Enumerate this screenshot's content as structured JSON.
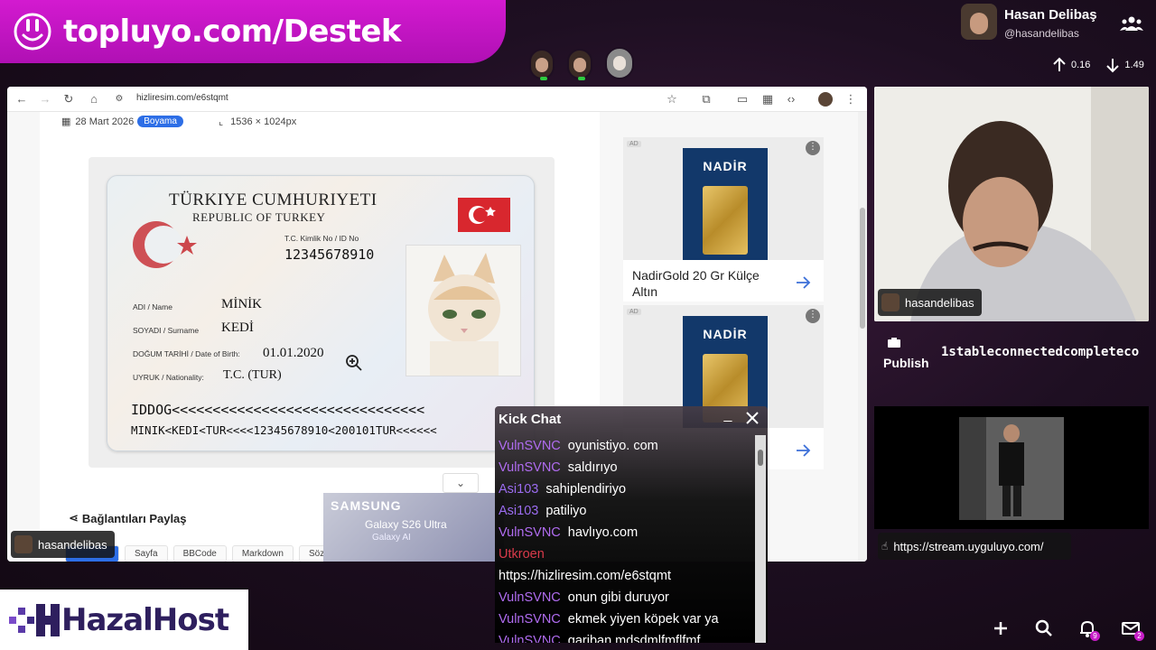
{
  "banner": {
    "text": "topluyo.com/Destek"
  },
  "profile": {
    "name": "Hasan Delibaş",
    "handle": "@hasandelibas"
  },
  "speed": {
    "up": "0.16",
    "down": "1.49"
  },
  "browser": {
    "url": "hizliresim.com/e6stqmt",
    "date": "28 Mart 2026",
    "category": "Boyama",
    "dimensions": "1536 × 1024px",
    "share_label": "Bağlantıları Paylaş",
    "share_tabs": [
      "Sayfa",
      "BBCode",
      "Markdown",
      "Söz"
    ]
  },
  "idcard": {
    "title1": "TÜRKIYE CUMHURIYETI",
    "title2": "REPUBLIC OF TURKEY",
    "id_label": "T.C. Kimlik No / ID No",
    "id_no": "12345678910",
    "name_label": "ADI / Name",
    "name": "MİNİK",
    "surname_label": "SOYADI / Surname",
    "surname": "KEDİ",
    "dob_label": "DOĞUM TARİHİ / Date of Birth:",
    "dob": "01.01.2020",
    "nat_label": "UYRUK / Nationality:",
    "nationality": "T.C. (TUR)",
    "mrz1": "IDDOG<<<<<<<<<<<<<<<<<<<<<<<<<<<<<<<",
    "mrz2": "MINIK<KEDI<TUR<<<<12345678910<200101TUR<<<<<<"
  },
  "samsung_ad": {
    "brand": "SAMSUNG",
    "model": "Galaxy S26 Ultra",
    "tagline": "Galaxy AI"
  },
  "ads": [
    {
      "tag": "AD",
      "brand": "NADİR",
      "title": "NadirGold 20 Gr Külçe Altın"
    },
    {
      "tag": "AD",
      "brand": "NADİR",
      "title": ""
    }
  ],
  "streamer_overlay": "hasandelibas",
  "publish": {
    "label": "Publish",
    "code": "1stableconnectedcompleteco"
  },
  "stream_link": "https://stream.uyguluyo.com/",
  "chat": {
    "title": "Kick Chat",
    "messages": [
      {
        "user": "VulnSVNC",
        "color": "#b06cf0",
        "text": "oyunistiyo. com"
      },
      {
        "user": "VulnSVNC",
        "color": "#b06cf0",
        "text": "saldırıyo"
      },
      {
        "user": "Asi103",
        "color": "#9b6cf0",
        "text": "sahiplendiriyo"
      },
      {
        "user": "Asi103",
        "color": "#9b6cf0",
        "text": "patiliyo"
      },
      {
        "user": "VulnSVNC",
        "color": "#b06cf0",
        "text": "havlıyo.com"
      },
      {
        "user": "Utkroen",
        "color": "#d83a4a",
        "text": ""
      },
      {
        "user": "",
        "color": "#ffffff",
        "text": "https://hizliresim.com/e6stqmt"
      },
      {
        "user": "VulnSVNC",
        "color": "#b06cf0",
        "text": "onun gibi duruyor"
      },
      {
        "user": "VulnSVNC",
        "color": "#b06cf0",
        "text": "ekmek yiyen köpek var ya"
      },
      {
        "user": "VulnSVNC",
        "color": "#b06cf0",
        "text": "gariban mdsdmlfmflfmf"
      }
    ]
  },
  "hazal": {
    "text": "HazalHost"
  },
  "bottom_icons": {
    "notifications_count": "9",
    "messages_count": "2"
  },
  "colors": {
    "brand_magenta": "#c81ec8",
    "chat_user": "#b06cf0",
    "accent_blue": "#2d6ee6"
  }
}
